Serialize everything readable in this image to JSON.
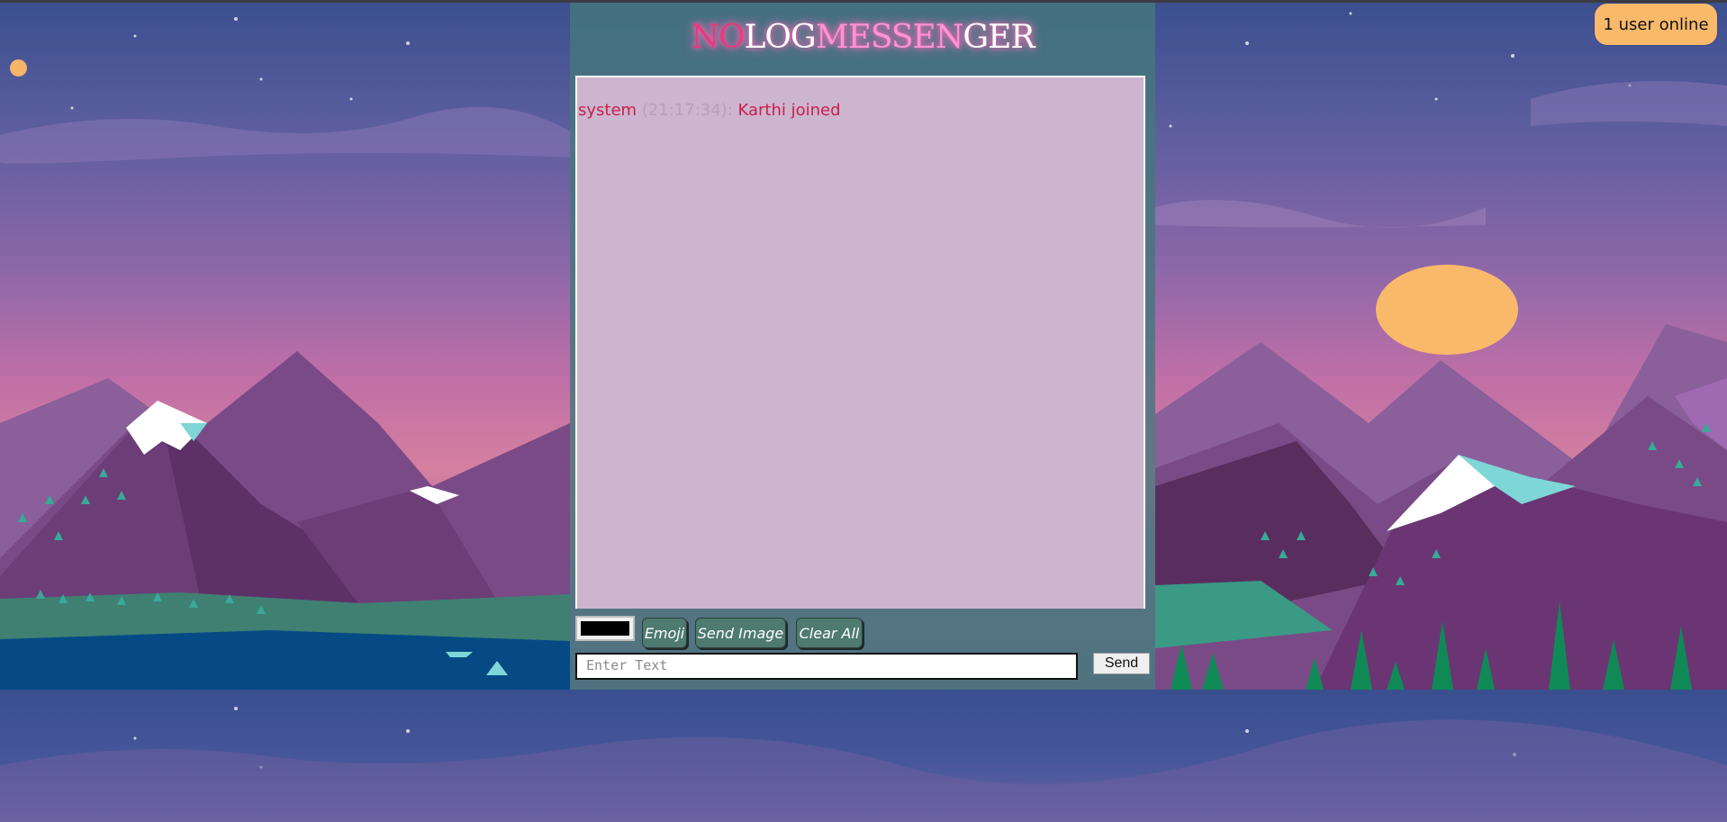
{
  "header": {
    "title_parts": [
      "NO",
      "LOG",
      "MESSEN",
      "GER"
    ]
  },
  "online": {
    "label": "1 user online"
  },
  "messages": [
    {
      "sender": "system",
      "time": "(21:17:34):",
      "text": "Karthi joined"
    }
  ],
  "toolbar": {
    "color_value": "#000000",
    "emoji_label": "Emoji",
    "send_image_label": "Send Image",
    "clear_all_label": "Clear All"
  },
  "composer": {
    "placeholder": "Enter Text",
    "value": "",
    "send_label": "Send"
  },
  "colors": {
    "badge": "#f9b96b",
    "message_area": "#cdb4cf",
    "system_message": "#c8204a",
    "panel": "#46787d",
    "title_accent": "#e43b7c"
  }
}
